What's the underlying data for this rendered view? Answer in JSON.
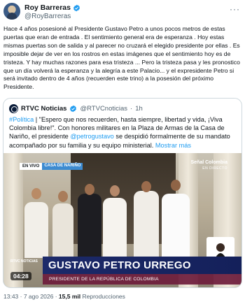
{
  "author": {
    "name": "Roy Barreras",
    "handle": "@RoyBarreras",
    "verified_color": "#1d9bf0"
  },
  "more_icon": "more-horizontal-icon",
  "tweet": {
    "text": "Hace 4 años posesioné al Presidente Gustavo Petro a unos pocos metros de estas puertas que eran de entrada . El sentimiento general era de esperanza . Hoy estas mismas puertas son de salida y al parecer no cruzará el elegido presidente por ellas . Es imposible dejar de ver en los rostros en estas imágenes que el sentimiento hoy es de tristeza. Y hay muchas razones para esa tristeza ... Pero la tristeza pasa y les pronostico que un día volverá la esperanza y la alegría a este Palacio... y el expresidente Petro si será invitado dentro de 4 años  (recuerden este trino) a la posesión del próximo Presidente."
  },
  "quote": {
    "name": "RTVC Noticias",
    "handle": "@RTVCnoticias",
    "separator": "·",
    "time": "1h",
    "hashtag": "#Política",
    "text_a": " | \"Espero que nos recuerden, hasta siempre, libertad y vida, ¡Viva Colombia libre!\". Con honores militares en la Plaza de Armas de la Casa de Nariño, el presidente ",
    "mention": "@petrogustavo",
    "text_b": " se despidió formalmente de su mandato acompañado por su familia y su equipo ministerial. ",
    "show_more": "Mostrar más"
  },
  "video": {
    "live_label": "EN VIVO",
    "location_label": "CASA DE NARIÑO",
    "channel_logo": "Señal Colombia",
    "channel_sub": "EN DIRECTO",
    "corner_logo": "RTVC NOTICIAS",
    "lower_third_name": "GUSTAVO PETRO URREGO",
    "lower_third_title": "PRESIDENTE DE LA REPÚBLICA DE COLOMBIA",
    "duration": "04:28"
  },
  "footer": {
    "time": "13:43 · 7 ago 2026 · ",
    "views": "15,5 mil",
    "views_label": " Reproducciones"
  }
}
